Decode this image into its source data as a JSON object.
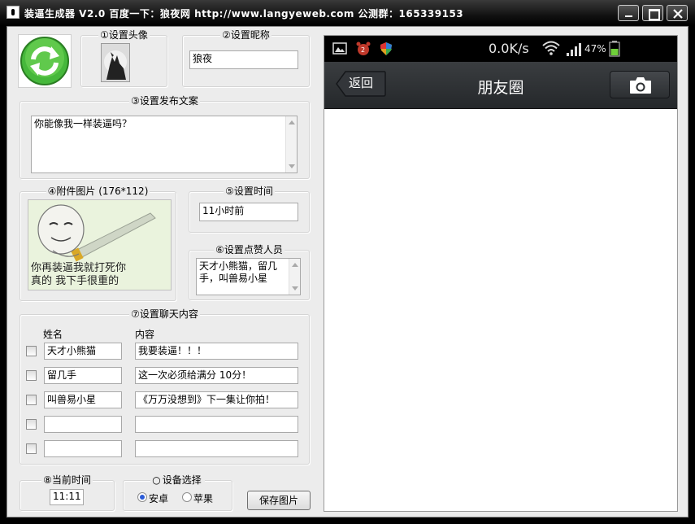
{
  "window": {
    "title": "装逼生成器 V2.0    百度一下：狼夜网  http://www.langyeweb.com  公测群：165339153"
  },
  "avatar": {
    "legend": "①设置头像"
  },
  "nickname": {
    "legend": "②设置昵称",
    "value": "狼夜"
  },
  "post": {
    "legend": "③设置发布文案",
    "value": "你能像我一样装逼吗？"
  },
  "image": {
    "legend": "④附件图片 (176*112)",
    "caption_line1": "你再装逼我就打死你",
    "caption_line2": "真的 我下手很重的"
  },
  "time": {
    "legend": "⑤设置时间",
    "value": "11小时前"
  },
  "likes": {
    "legend": "⑥设置点赞人员",
    "value_line1": "天才小熊猫，留几",
    "value_line2": "手，叫兽易小星"
  },
  "chat": {
    "legend": "⑦设置聊天内容",
    "header_name": "姓名",
    "header_content": "内容",
    "rows": [
      {
        "name": "天才小熊猫",
        "content": "我要装逼！！！"
      },
      {
        "name": "留几手",
        "content": "这一次必须给满分 10分！"
      },
      {
        "name": "叫兽易小星",
        "content": "《万万没想到》下一集让你拍！"
      },
      {
        "name": "",
        "content": ""
      },
      {
        "name": "",
        "content": ""
      }
    ]
  },
  "clock": {
    "legend": "⑧当前时间",
    "value": "11:11"
  },
  "device": {
    "legend": "设备选择",
    "option_android": "安卓",
    "option_apple": "苹果",
    "selected": "安卓"
  },
  "save_button": "保存图片",
  "phone": {
    "status_speed": "0.0K/s",
    "battery": "47%",
    "back_label": "返回",
    "nav_title": "朋友圈"
  },
  "colors": {
    "refresh_green": "#46b83b",
    "battery_green": "#6fcf3a",
    "radio_selected": "#2a5bd7"
  }
}
